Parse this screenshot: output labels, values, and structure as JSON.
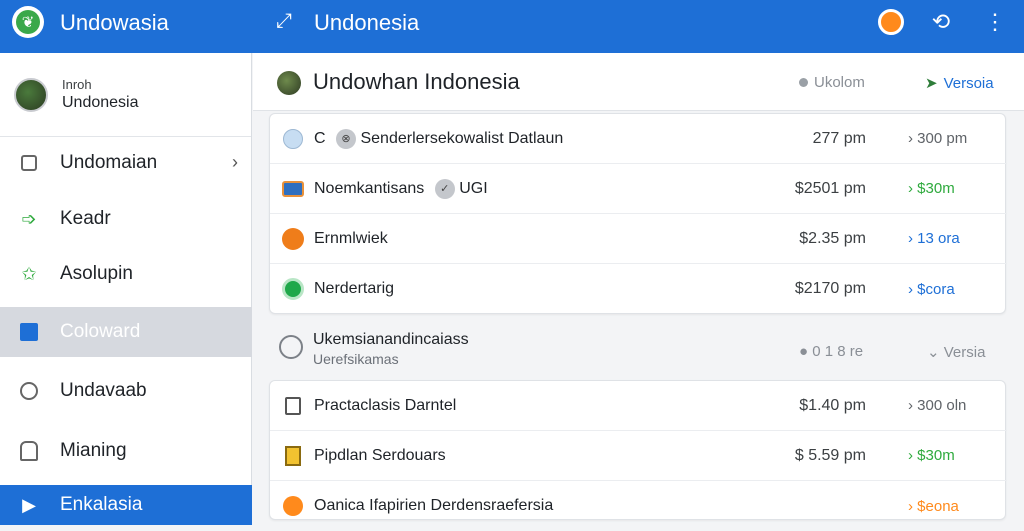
{
  "app": {
    "title": "Undowasia",
    "page_title": "Undonesia",
    "colors": {
      "topbar": "#1e6fd6",
      "accent_green": "#2faa3e",
      "accent_orange": "#ff8a1c"
    }
  },
  "icons": {
    "logo": "leaf-icon",
    "back": "back-arrow-icon",
    "settings": "gear-icon",
    "refresh": "refresh-icon",
    "more": "more-vertical-icon"
  },
  "sidebar": {
    "profile": {
      "small": "Inroh",
      "name": "Undonesia"
    },
    "items": [
      {
        "label": "Undomaian",
        "icon": "grid-icon"
      },
      {
        "label": "Keadr",
        "icon": "arrow-icon"
      },
      {
        "label": "Asolupin",
        "icon": "star-icon"
      },
      {
        "label": "Coloward",
        "icon": "bag-icon"
      },
      {
        "label": "Undavaab",
        "icon": "shield-icon"
      },
      {
        "label": "Mianing",
        "icon": "document-icon"
      },
      {
        "label": "Enkalasia",
        "icon": "play-icon"
      }
    ]
  },
  "main": {
    "header": {
      "title": "Undowhan Indonesia",
      "col1": "Ukolom",
      "col2": "Versoia"
    },
    "list1": [
      {
        "name": "C",
        "tag": "⊗",
        "name_rest": "Senderlersekowalist Datlaun",
        "amount": "277 pm",
        "status": "› 300 pm",
        "status_color": "#5f6368",
        "icon": "scale-icon"
      },
      {
        "name": "Noemkantisans",
        "tag": "✓",
        "name_rest": "UGI",
        "amount": "$2501 pm",
        "status": "› $30m",
        "status_color": "#2faa3e",
        "icon": "card-icon"
      },
      {
        "name": "Ernmlwiek",
        "tag": "",
        "name_rest": "",
        "amount": "$2.35 pm",
        "status": "› 13 ora",
        "status_color": "#1e6fd6",
        "icon": "orange-circle-icon"
      },
      {
        "name": "Nerdertarig",
        "tag": "",
        "name_rest": "",
        "amount": "$2170 pm",
        "status": "› $cora",
        "status_color": "#1e6fd6",
        "icon": "green-circle-icon"
      }
    ],
    "section": {
      "title": "Ukemsianandincaiass",
      "subtitle": "Uerefsikamas",
      "amount": "● 0 1 8 re",
      "version": "⌄ Versia"
    },
    "list2": [
      {
        "name": "Practaclasis Darntel",
        "amount": "$1.40 pm",
        "status": "› 300 oln",
        "status_color": "#5f6368",
        "icon": "page-icon"
      },
      {
        "name": "Pipdlan Serdouars",
        "amount": "$ 5.59 pm",
        "status": "› $30m",
        "status_color": "#2faa3e",
        "icon": "yellow-doc-icon"
      },
      {
        "name": "Oanica Ifapirien Derdensraefersia",
        "amount": "",
        "status": "› $eona",
        "status_color": "#ff8a1c",
        "icon": "orange-shield-icon"
      }
    ]
  }
}
